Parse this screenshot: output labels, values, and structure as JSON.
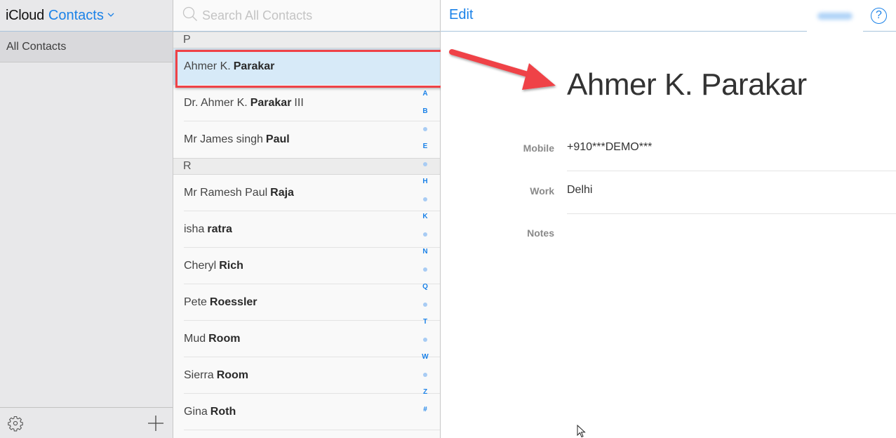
{
  "sidebar": {
    "brand": "iCloud",
    "app_name": "Contacts",
    "app_menu_icon": "chevron-down-icon",
    "groups": [
      {
        "label": "All Contacts",
        "selected": true
      }
    ],
    "footer": {
      "settings_icon": "gear-icon",
      "add_icon": "plus-icon"
    }
  },
  "list": {
    "search": {
      "placeholder": "Search All Contacts",
      "value": "",
      "icon": "search-icon"
    },
    "sections": [
      {
        "letter": "P",
        "contacts": [
          {
            "first": "Ahmer K.",
            "last": "Parakar",
            "suffix": "",
            "selected": true
          },
          {
            "first": "Dr. Ahmer K.",
            "last": "Parakar",
            "suffix": "III",
            "selected": false
          },
          {
            "first": "Mr James singh",
            "last": "Paul",
            "suffix": "",
            "selected": false
          }
        ]
      },
      {
        "letter": "R",
        "contacts": [
          {
            "first": "Mr Ramesh Paul",
            "last": "Raja",
            "suffix": "",
            "selected": false
          },
          {
            "first": "isha",
            "last": "ratra",
            "suffix": "",
            "selected": false
          },
          {
            "first": "Cheryl",
            "last": "Rich",
            "suffix": "",
            "selected": false
          },
          {
            "first": "Pete",
            "last": "Roessler",
            "suffix": "",
            "selected": false
          },
          {
            "first": "Mud",
            "last": "Room",
            "suffix": "",
            "selected": false
          },
          {
            "first": "Sierra",
            "last": "Room",
            "suffix": "",
            "selected": false
          },
          {
            "first": "Gina",
            "last": "Roth",
            "suffix": "",
            "selected": false
          }
        ]
      }
    ],
    "index": [
      "A",
      "B",
      "•",
      "E",
      "•",
      "H",
      "•",
      "K",
      "•",
      "N",
      "•",
      "Q",
      "•",
      "T",
      "•",
      "W",
      "•",
      "Z",
      "#"
    ]
  },
  "detail": {
    "edit_label": "Edit",
    "share_label": "Share",
    "help_label": "?",
    "name": "Ahmer K. Parakar",
    "fields": [
      {
        "label": "Mobile",
        "value": "+910***DEMO***"
      },
      {
        "label": "Work",
        "value": "Delhi"
      },
      {
        "label": "Notes",
        "value": ""
      }
    ]
  },
  "annotation": {
    "highlight_color": "#ef4247",
    "arrow_color": "#ef4247"
  },
  "colors": {
    "accent": "#1b82e8",
    "selected_row": "#d7eaf8"
  }
}
